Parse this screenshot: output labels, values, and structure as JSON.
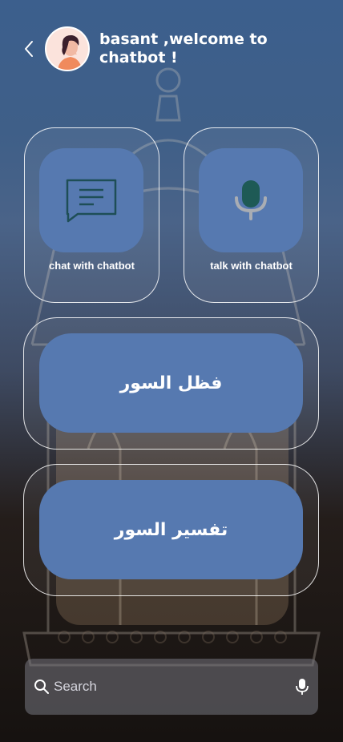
{
  "header": {
    "back_icon": "chevron-left-icon",
    "avatar_icon": "user-avatar",
    "title": "basant ,welcome to chatbot !"
  },
  "cards": {
    "chat": {
      "label": "chat with chatbot",
      "icon": "chat-bubble-icon"
    },
    "talk": {
      "label": "talk with chatbot",
      "icon": "microphone-icon"
    }
  },
  "buttons": {
    "surah_virtues": "فظل السور",
    "surah_tafsir": "تفسير السور"
  },
  "search": {
    "placeholder": "Search",
    "search_icon": "search-icon",
    "mic_icon": "microphone-icon"
  },
  "colors": {
    "tile": "#5679b0",
    "icon_dark": "#1e4e56",
    "text": "#ffffff"
  }
}
